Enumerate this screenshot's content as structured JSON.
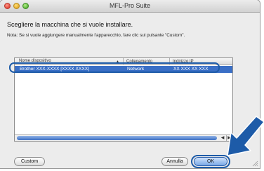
{
  "window": {
    "title": "MFL-Pro Suite"
  },
  "heading": "Scegliere la macchina che si vuole installare.",
  "note": "Nota: Se si vuole aggiungere manualmente l'apparecchio, fare clic sul pulsante \"Custom\".",
  "table": {
    "columns": [
      "Nome dispositivo",
      "Collegamento",
      "Indirizzo IP"
    ],
    "sort_arrow": "▲",
    "rows": [
      {
        "name": "Brother XXX-XXXX [XXXX XXXX]",
        "connection": "Network",
        "ip": "XX XXX XX XXX"
      }
    ]
  },
  "scroll": {
    "left": "◀",
    "right": "▶"
  },
  "buttons": {
    "custom": "Custom",
    "cancel": "Annulla",
    "ok": "OK"
  },
  "colors": {
    "selection": "#3a6fc6",
    "annotation": "#1d5ba8"
  },
  "icons": [
    "close-icon",
    "minimize-icon",
    "zoom-icon",
    "sort-ascending-icon",
    "scroll-left-icon",
    "scroll-right-icon",
    "resize-grip-icon",
    "pointer-arrow-icon"
  ]
}
